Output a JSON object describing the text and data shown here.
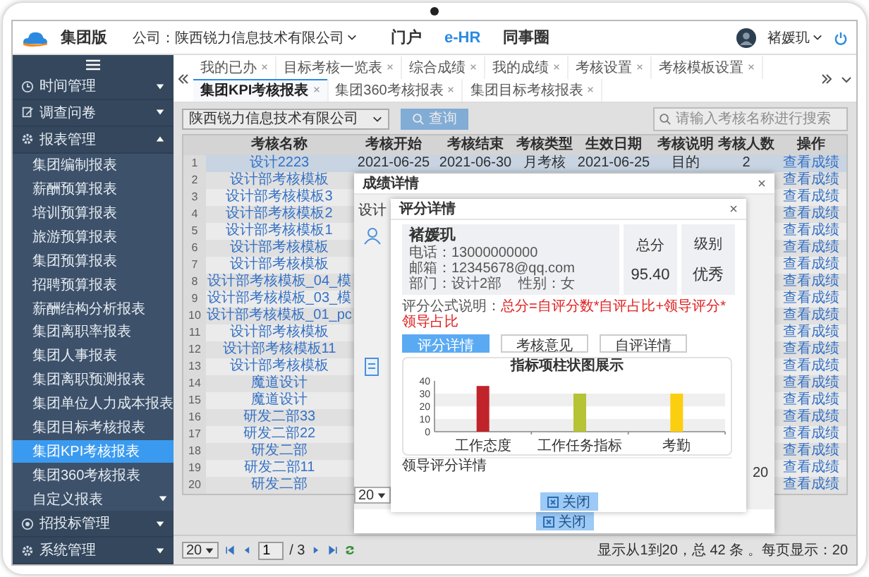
{
  "header": {
    "brand": "集团版",
    "company": "公司：陕西锐力信息技术有限公司",
    "nav": [
      {
        "label": "门户",
        "selected": false
      },
      {
        "label": "e-HR",
        "selected": true
      },
      {
        "label": "同事圈",
        "selected": false
      }
    ],
    "user": "褚媛玑"
  },
  "sidebar": {
    "items": [
      {
        "label": "时间管理",
        "expanded": false
      },
      {
        "label": "调查问卷",
        "expanded": false
      },
      {
        "label": "报表管理",
        "expanded": true,
        "children": [
          {
            "label": "集团编制报表",
            "selected": false,
            "expandable": false
          },
          {
            "label": "薪酬预算报表",
            "selected": false,
            "expandable": false
          },
          {
            "label": "培训预算报表",
            "selected": false,
            "expandable": false
          },
          {
            "label": "旅游预算报表",
            "selected": false,
            "expandable": false
          },
          {
            "label": "集团预算报表",
            "selected": false,
            "expandable": false
          },
          {
            "label": "招聘预算报表",
            "selected": false,
            "expandable": false
          },
          {
            "label": "薪酬结构分析报表",
            "selected": false,
            "expandable": false
          },
          {
            "label": "集团离职率报表",
            "selected": false,
            "expandable": false
          },
          {
            "label": "集团人事报表",
            "selected": false,
            "expandable": false
          },
          {
            "label": "集团离职预测报表",
            "selected": false,
            "expandable": false
          },
          {
            "label": "集团单位人力成本报表",
            "selected": false,
            "expandable": false
          },
          {
            "label": "集团目标考核报表",
            "selected": false,
            "expandable": false
          },
          {
            "label": "集团KPI考核报表",
            "selected": true,
            "expandable": false
          },
          {
            "label": "集团360考核报表",
            "selected": false,
            "expandable": false
          },
          {
            "label": "自定义报表",
            "selected": false,
            "expandable": true
          }
        ]
      },
      {
        "label": "招投标管理",
        "expanded": false
      },
      {
        "label": "系统管理",
        "expanded": false
      }
    ]
  },
  "tabs": [
    {
      "label": "我的已办",
      "selected": false
    },
    {
      "label": "目标考核一览表",
      "selected": false
    },
    {
      "label": "综合成绩",
      "selected": false
    },
    {
      "label": "我的成绩",
      "selected": false
    },
    {
      "label": "考核设置",
      "selected": false
    },
    {
      "label": "考核模板设置",
      "selected": false
    },
    {
      "label": "集团KPI考核报表",
      "selected": true
    },
    {
      "label": "集团360考核报表",
      "selected": false
    },
    {
      "label": "集团目标考核报表",
      "selected": false
    }
  ],
  "toolbar": {
    "company_select": "陕西锐力信息技术有限公司",
    "query_button": "查询",
    "search_placeholder": "请输入考核名称进行搜索"
  },
  "table": {
    "columns": [
      "考核名称",
      "考核开始",
      "考核结束",
      "考核类型",
      "生效日期",
      "考核说明",
      "考核人数",
      "操作"
    ],
    "rows": [
      {
        "no": "1",
        "name": "设计2223",
        "start": "2021-06-25",
        "end": "2021-06-30",
        "type": "月考核",
        "effective": "2021-06-25",
        "note": "目的",
        "count": "2",
        "action": "查看成绩",
        "selected": true
      },
      {
        "no": "2",
        "name": "设计部考核模板",
        "action": "查看成绩",
        "selected": false
      },
      {
        "no": "3",
        "name": "设计部考核模板3",
        "action": "查看成绩",
        "selected": false
      },
      {
        "no": "4",
        "name": "设计部考核模板2",
        "action": "查看成绩",
        "selected": false
      },
      {
        "no": "5",
        "name": "设计部考核模板1",
        "action": "查看成绩",
        "selected": false
      },
      {
        "no": "6",
        "name": "设计部考核模板",
        "action": "查看成绩",
        "selected": false
      },
      {
        "no": "7",
        "name": "设计部考核模板",
        "action": "查看成绩",
        "selected": false
      },
      {
        "no": "8",
        "name": "设计部考核模板_04_模",
        "action": "查看成绩",
        "selected": false
      },
      {
        "no": "9",
        "name": "设计部考核模板_03_模",
        "action": "查看成绩",
        "selected": false
      },
      {
        "no": "10",
        "name": "设计部考核模板_01_pc",
        "action": "查看成绩",
        "selected": false
      },
      {
        "no": "11",
        "name": "设计部考核模板",
        "action": "查看成绩",
        "selected": false
      },
      {
        "no": "12",
        "name": "设计部考核模板11",
        "action": "查看成绩",
        "selected": false
      },
      {
        "no": "13",
        "name": "设计部考核模板",
        "action": "查看成绩",
        "selected": false
      },
      {
        "no": "14",
        "name": "魔道设计",
        "action": "查看成绩",
        "selected": false
      },
      {
        "no": "15",
        "name": "魔道设计",
        "action": "查看成绩",
        "selected": false
      },
      {
        "no": "16",
        "name": "研发二部33",
        "action": "查看成绩",
        "selected": false
      },
      {
        "no": "17",
        "name": "研发二部22",
        "action": "查看成绩",
        "selected": false
      },
      {
        "no": "18",
        "name": "研发二部",
        "action": "查看成绩",
        "selected": false
      },
      {
        "no": "19",
        "name": "研发二部11",
        "action": "查看成绩",
        "selected": false
      },
      {
        "no": "20",
        "name": "研发二部",
        "action": "查看成绩",
        "selected": false
      }
    ]
  },
  "pager": {
    "page_size": "20",
    "page": "1",
    "total_pages": "/ 3",
    "summary": "显示从1到20，总 42 条 。每页显示：20"
  },
  "score_dialog": {
    "title": "成绩详情",
    "partial_text": "设计",
    "page_size": "20",
    "right_text": "20",
    "close_button": "关闭"
  },
  "detail_dialog": {
    "title": "评分详情",
    "name": "褚媛玑",
    "phone": "电话：13000000000",
    "email": "邮箱：12345678@qq.com",
    "department": "部门：设计2部",
    "gender": "性别：女",
    "total_label": "总分",
    "total": "95.40",
    "grade_label": "级别",
    "grade": "优秀",
    "formula_label": "评分公式说明：",
    "formula": "总分=自评分数*自评占比+领导评分*领导占比",
    "tabs": [
      {
        "label": "评分详情",
        "selected": true
      },
      {
        "label": "考核意见",
        "selected": false
      },
      {
        "label": "自评详情",
        "selected": false
      }
    ],
    "chart_data": {
      "type": "bar",
      "title": "指标项柱状图展示",
      "categories": [
        "工作态度",
        "工作任务指标",
        "考勤"
      ],
      "values": [
        36,
        30,
        30
      ],
      "ylim": [
        0,
        40
      ],
      "yticks": [
        0,
        10,
        20,
        30,
        40
      ]
    },
    "leader_section": "领导评分详情",
    "close_button": "关闭"
  }
}
